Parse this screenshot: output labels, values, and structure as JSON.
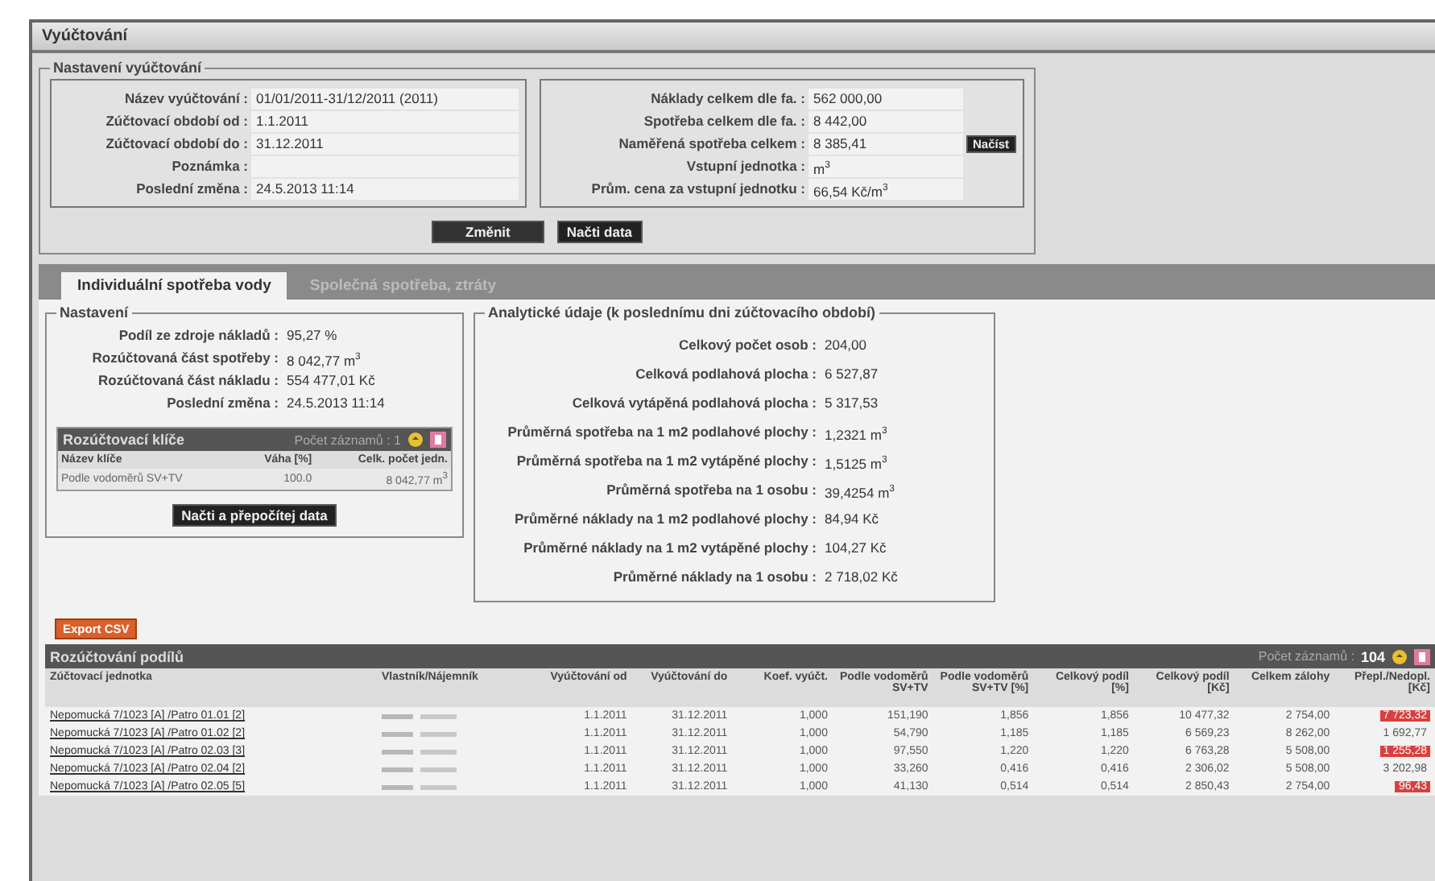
{
  "window": {
    "title": "Vyúčtování"
  },
  "settings": {
    "legend": "Nastavení vyúčtování",
    "left_fields": [
      {
        "label": "Název vyúčtování :",
        "value": "01/01/2011-31/12/2011 (2011)"
      },
      {
        "label": "Zúčtovací období od :",
        "value": "1.1.2011"
      },
      {
        "label": "Zúčtovací období do :",
        "value": "31.12.2011"
      },
      {
        "label": "Poznámka :"
      },
      {
        "label": "Poslední změna :",
        "value": "24.5.2013 11:14"
      }
    ],
    "right_fields": [
      {
        "label": "Náklady celkem dle fa. :",
        "value": "562 000,00"
      },
      {
        "label": "Spotřeba celkem dle fa. :",
        "value": "8 442,00"
      },
      {
        "label": "Naměřená spotřeba celkem :",
        "value": "8 385,41",
        "button": "Načíst"
      },
      {
        "label": "Vstupní jednotka :",
        "value": "m$^{3}$"
      },
      {
        "label": "Prům. cena za vstupní jednotku :",
        "value": "66,54 Kč/m$^{3}$"
      }
    ],
    "buttons": [
      "Změnit",
      "Načti data"
    ]
  },
  "tabs": [
    {
      "label": "Individuální spotřeba vody",
      "selected": true
    },
    {
      "label": "Společná spotřeba, ztráty",
      "selected": false
    }
  ],
  "nastaveni": {
    "legend": "Nastavení",
    "fields": [
      {
        "label": "Podíl ze zdroje nákladů :",
        "value": "95,27 %"
      },
      {
        "label": "Rozúčtovaná část spotřeby :",
        "value": "8 042,77 m$^{3}$"
      },
      {
        "label": "Rozúčtovaná část nákladu :",
        "value": "554 477,01 Kč"
      },
      {
        "label": "Poslední změna :",
        "value": "24.5.2013 11:14"
      }
    ],
    "keys_grid": {
      "title": "Rozúčtovací klíče",
      "count": "Počet záznamů : 1",
      "columns": [
        "Název klíče",
        "Váha [%]",
        "Celk. počet jedn."
      ],
      "rows": [
        [
          "Podle vodoměrů SV+TV",
          "100.0",
          "8 042,77 m$^{3}$"
        ]
      ]
    },
    "button": "Načti a přepočítej data"
  },
  "analytics": {
    "legend": "Analytické údaje (k poslednímu dni zúčtovacího období)",
    "fields": [
      {
        "label": "Celkový počet osob :",
        "value": "204,00"
      },
      {
        "label": "Celková podlahová plocha :",
        "value": "6 527,87"
      },
      {
        "label": "Celková vytápěná podlahová plocha :",
        "value": "5 317,53"
      },
      {
        "label": "Průměrná spotřeba na 1 m2 podlahové plochy :",
        "value": "1,2321 m$^{3}$"
      },
      {
        "label": "Průměrná spotřeba na 1 m2 vytápěné plochy :",
        "value": "1,5125 m$^{3}$"
      },
      {
        "label": "Průměrná spotřeba na 1 osobu :",
        "value": "39,4254 m$^{3}$"
      },
      {
        "label": "Průměrné náklady na 1 m2 podlahové plochy :",
        "value": "84,94 Kč"
      },
      {
        "label": "Průměrné náklady na 1 m2 vytápěné plochy :",
        "value": "104,27 Kč"
      },
      {
        "label": "Průměrné náklady na 1 osobu :",
        "value": "2 718,02 Kč"
      }
    ]
  },
  "export_button": "Export CSV",
  "grid": {
    "title": "Rozúčtování podílů",
    "count": "Počet záznamů :",
    "total": "104",
    "columns": [
      "Zúčtovací jednotka",
      "Vlastník/Nájemník",
      "Vyúčtování od",
      "Vyúčtování do",
      "Koef. vyúčt.",
      "Podle vodoměrů SV+TV",
      "Podle vodoměrů SV+TV [%]",
      "Celkový podíl [%]",
      "Celkový podíl [Kč]",
      "Celkem zálohy",
      "Přepl./Nedopl. [Kč]"
    ],
    "rows": [
      {
        "unit": "Nepomucká 7/1023 [A] /Patro 01.01 [2]",
        "from": "1.1.2011",
        "to": "31.12.2011",
        "coef": "1,000",
        "sv": "151,190",
        "svp": "1,856",
        "pct": "1,856",
        "czk": "10 477,32",
        "adv": "2 754,00",
        "bal": "7 723,32",
        "highlighted": true
      },
      {
        "unit": "Nepomucká 7/1023 [A] /Patro 01.02 [2]",
        "from": "1.1.2011",
        "to": "31.12.2011",
        "coef": "1,000",
        "sv": "54,790",
        "svp": "1,185",
        "pct": "1,185",
        "czk": "6 569,23",
        "adv": "8 262,00",
        "bal": "1 692,77",
        "highlighted": false
      },
      {
        "unit": "Nepomucká 7/1023 [A] /Patro 02.03 [3]",
        "from": "1.1.2011",
        "to": "31.12.2011",
        "coef": "1,000",
        "sv": "97,550",
        "svp": "1,220",
        "pct": "1,220",
        "czk": "6 763,28",
        "adv": "5 508,00",
        "bal": "1 255,28",
        "highlighted": true
      },
      {
        "unit": "Nepomucká 7/1023 [A] /Patro 02.04 [2]",
        "from": "1.1.2011",
        "to": "31.12.2011",
        "coef": "1,000",
        "sv": "33,260",
        "svp": "0,416",
        "pct": "0,416",
        "czk": "2 306,02",
        "adv": "5 508,00",
        "bal": "3 202,98",
        "highlighted": false
      },
      {
        "unit": "Nepomucká 7/1023 [A] /Patro 02.05 [5]",
        "from": "1.1.2011",
        "to": "31.12.2011",
        "coef": "1,000",
        "sv": "41,130",
        "svp": "0,514",
        "pct": "0,514",
        "czk": "2 850,43",
        "adv": "2 754,00",
        "bal": "96,43",
        "highlighted": true
      }
    ]
  }
}
